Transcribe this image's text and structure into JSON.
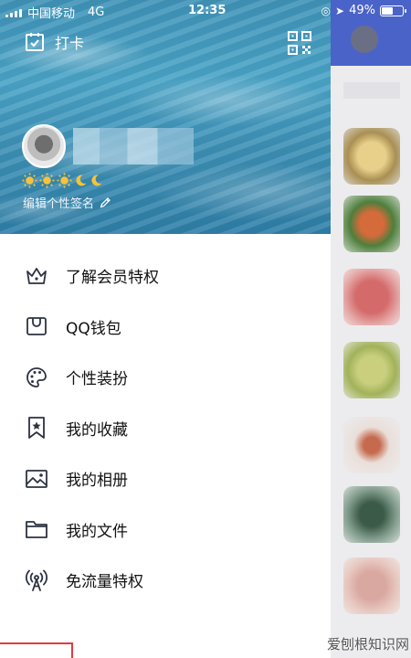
{
  "status_bar": {
    "carrier": "中国移动",
    "network": "4G",
    "time": "12:35",
    "battery_pct": "49%",
    "battery_level": 0.49
  },
  "header": {
    "checkin_label": "打卡",
    "signature": "编辑个性签名",
    "level_icons": [
      "sun-icon",
      "sun-icon",
      "sun-icon",
      "moon-icon",
      "moon-icon"
    ]
  },
  "menu": {
    "items": [
      {
        "label": "了解会员特权",
        "icon": "crown-icon"
      },
      {
        "label": "QQ钱包",
        "icon": "wallet-icon"
      },
      {
        "label": "个性装扮",
        "icon": "palette-icon"
      },
      {
        "label": "我的收藏",
        "icon": "bookmark-star-icon"
      },
      {
        "label": "我的相册",
        "icon": "photo-icon"
      },
      {
        "label": "我的文件",
        "icon": "folder-icon"
      },
      {
        "label": "免流量特权",
        "icon": "signal-tower-icon"
      }
    ]
  },
  "colors": {
    "accent_blue": "#4a63c8",
    "icon_stroke": "#2d3242",
    "highlight_red": "#e23b3b"
  },
  "watermark": "爱刨根知识网"
}
